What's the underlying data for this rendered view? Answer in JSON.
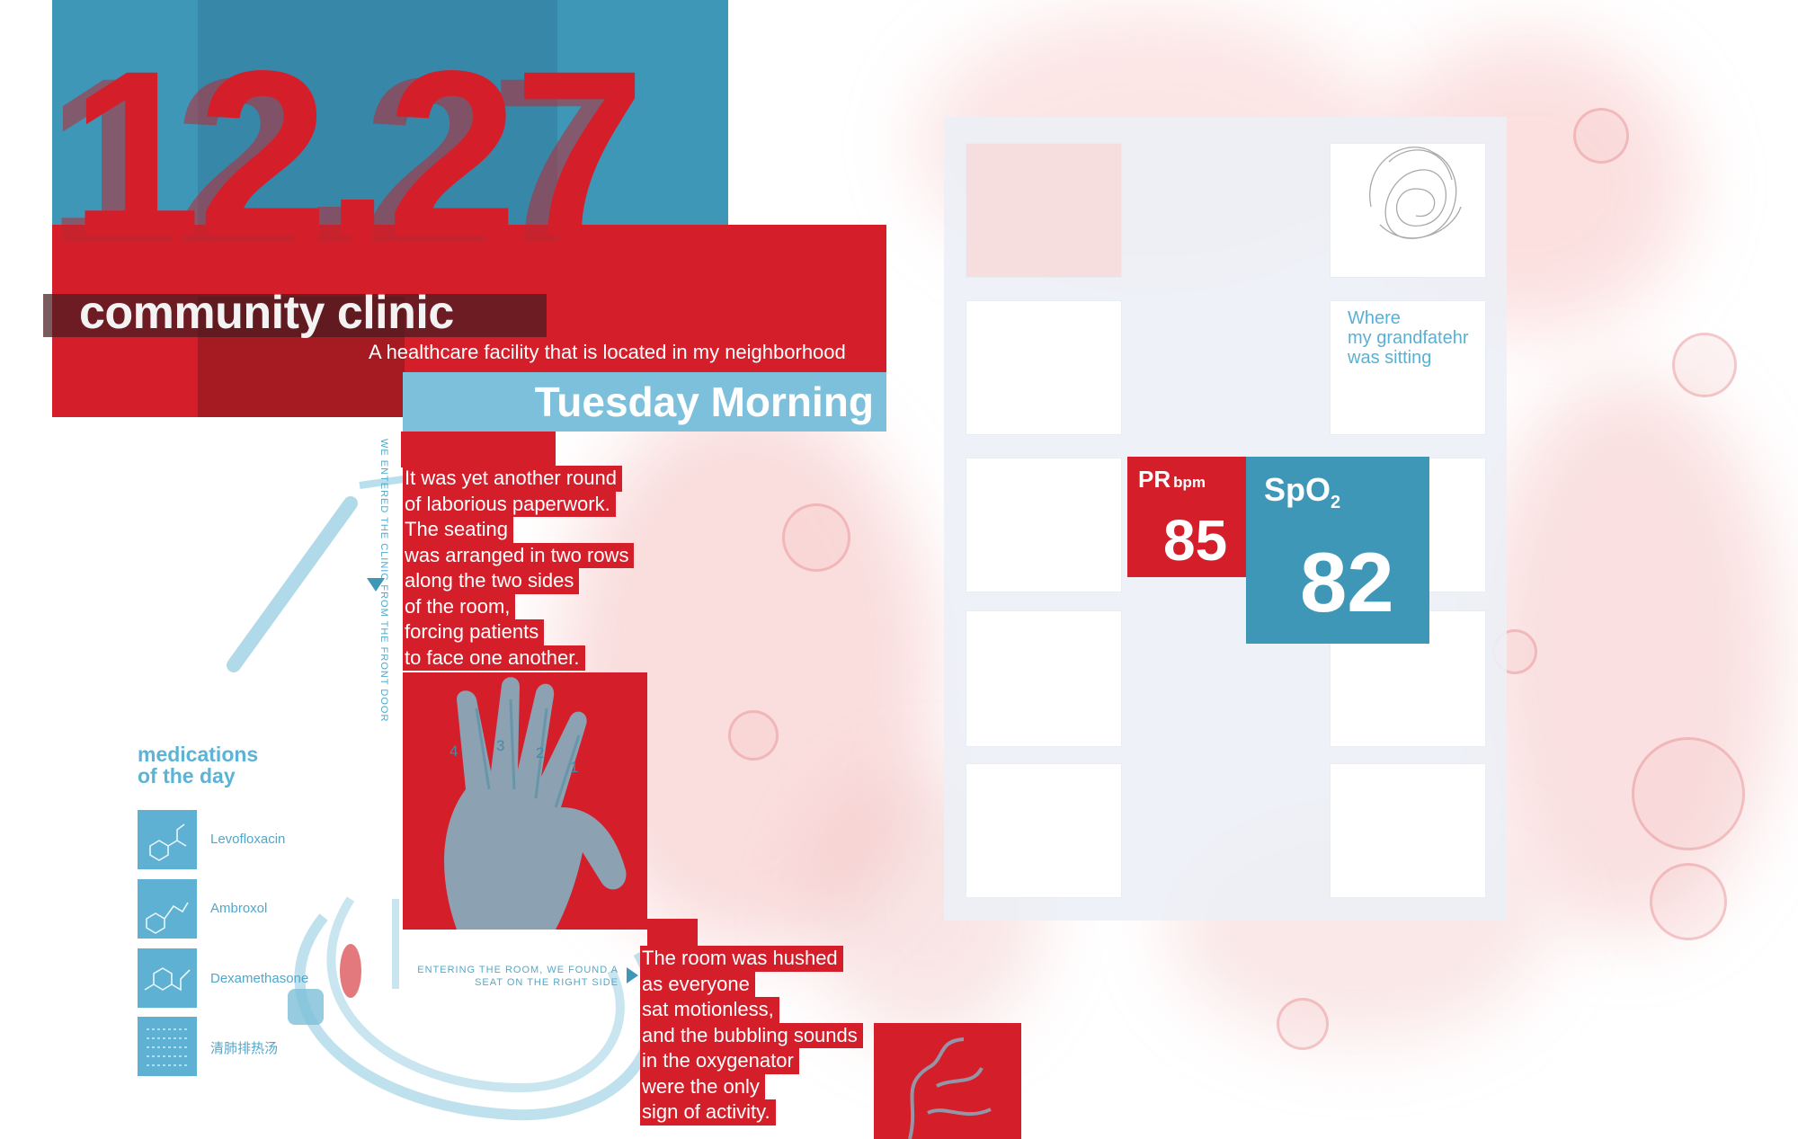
{
  "header": {
    "date": "12.27",
    "title": "community clinic",
    "subtitle": "A healthcare facility that is located in my neighborhood",
    "weekday": "Tuesday Morning"
  },
  "entry_caption": "WE ENTERED THE CLINIC FROM THE FRONT DOOR",
  "story": [
    "It was yet another round",
    "of laborious paperwork.",
    "The seating",
    "was arranged in two rows",
    "along the two sides",
    "of the room,",
    "forcing patients",
    "to face one another."
  ],
  "hand_numbers": [
    "4",
    "3",
    "2",
    "1"
  ],
  "room_caption": "ENTERING THE ROOM, WE FOUND A SEAT ON THE RIGHT SIDE",
  "story2": [
    "The room was hushed",
    "as everyone",
    "sat motionless,",
    "and the bubbling sounds",
    "in the oxygenator",
    "were the only",
    "sign of activity."
  ],
  "medications": {
    "title_line1": "medications",
    "title_line2": "of the day",
    "items": [
      "Levofloxacin",
      "Ambroxol",
      "Dexamethasone",
      "清肺排热汤"
    ]
  },
  "seat_caption": {
    "line1": "Where",
    "line2": "my grandfatehr",
    "line3": "was sitting"
  },
  "vitals": {
    "pr_label": "PR",
    "pr_unit": "bpm",
    "pr_value": "85",
    "spo2_label": "SpO",
    "spo2_sub": "2",
    "spo2_value": "82"
  },
  "colors": {
    "red": "#d41f2b",
    "blue": "#3f97b7",
    "light_blue": "#7cc0dc"
  }
}
